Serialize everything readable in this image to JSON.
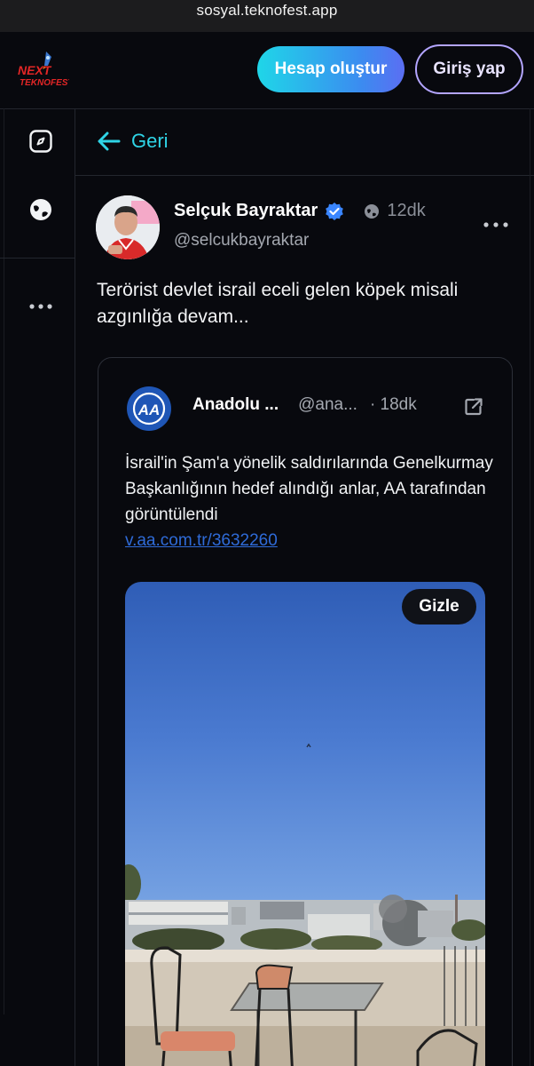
{
  "browser": {
    "url": "sosyal.teknofest.app"
  },
  "header": {
    "logo_text": "NEXT TEKNOFEST",
    "signup_label": "Hesap oluştur",
    "login_label": "Giriş yap"
  },
  "sidebar": {
    "icons": [
      "compass-icon",
      "globe-icon",
      "more-icon"
    ]
  },
  "nav": {
    "back_label": "Geri"
  },
  "post": {
    "author_name": "Selçuk Bayraktar",
    "verified": true,
    "time": "12dk",
    "handle": "@selcukbayraktar",
    "text": "Terörist devlet israil eceli gelen köpek misali azgınlığa devam...",
    "quote": {
      "author_name": "Anadolu ...",
      "handle": "@ana...",
      "time": "· 18dk",
      "text": "İsrail'in Şam'a yönelik saldırılarında Genelkurmay Başkanlığının hedef alındığı anlar, AA tarafından görüntülendi",
      "link": "v.aa.com.tr/3632260",
      "media_hide_label": "Gizle"
    }
  },
  "colors": {
    "accent": "#2fd4e6",
    "verified": "#3a86ff",
    "link": "#2f6bd8",
    "login_border": "#b3a5ff",
    "background": "#08090e"
  }
}
